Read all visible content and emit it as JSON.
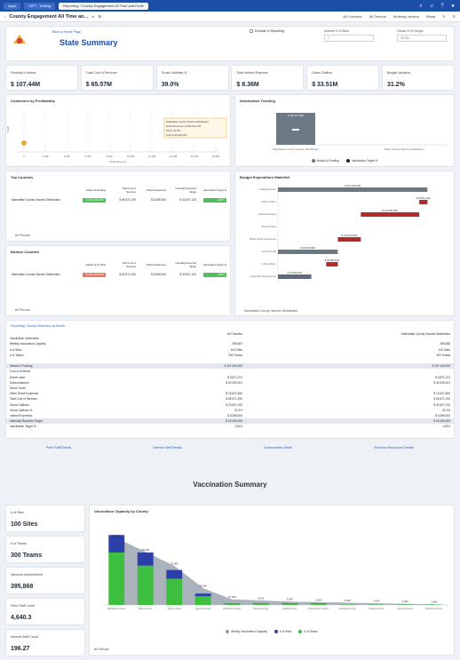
{
  "topnav": {
    "apps": "Apps",
    "tab1": "CIFT - Testing",
    "tab2": "Reporting / County Engagement All Time and Profit"
  },
  "subbar": {
    "title": "County Engagement All Time an...",
    "filter1": "All Counties",
    "filter2": "All Periods",
    "filter3": "Working Version",
    "filter4": "Reset"
  },
  "header": {
    "back_link": "Back to Home Page",
    "title": "State Summary",
    "checkbox_label": "Exclude in Reporting",
    "field1_label": "Number # & Rank",
    "field1_value": "7",
    "field2_label": "Global Of % Target",
    "field2_value": "90.0%"
  },
  "kpis": [
    {
      "label": "Funding & Inflows",
      "value": "$ 107.44M"
    },
    {
      "label": "Total Cost of Services",
      "value": "$ 65.57M"
    },
    {
      "label": "Gross Outflows %",
      "value": "39.0%"
    },
    {
      "label": "Total Indirect Expense",
      "value": "$ 8.36M"
    },
    {
      "label": "Gross Outflow",
      "value": "$ 33.51M"
    },
    {
      "label": "Budget Variance",
      "value": "31.2%"
    }
  ],
  "customers_chart": {
    "title": "Customers by Profitability",
    "ylabel": "Profit",
    "xlabel": "Total Revenue",
    "xticks": [
      "0",
      "2.0M",
      "4.0M",
      "6.0M",
      "8.0M",
      "10.0M",
      "12.0M",
      "14.0M",
      "16.0M",
      "18.0M"
    ],
    "tooltip_title": "Manhattan County Vaccine Distribution",
    "tooltip_l1": "Gross Revenue: $ 103,012,178",
    "tooltip_l2": "Profit: 10.3%",
    "tooltip_l3": "Cost: $ 19,301,241"
  },
  "distribution_chart": {
    "title": "Distribution Tracking",
    "bar_label": "$ 105,477,886",
    "cat1": "Manhattan County Vaccine Distribution",
    "cat2": "Other County Vaccine Distribution",
    "legend1": "Inflows & Funding",
    "legend2": "Vaccination Target %"
  },
  "top_counties": {
    "title": "Top Counties",
    "headers": [
      "Inflows & Funding",
      "Total Cost of Services",
      "Indirect Expenses",
      "Internally Reported Target",
      "Vaccination Target %"
    ],
    "row_name": "Manhattan County Vaccine Distribution",
    "row_values": [
      "$ 107,440,000",
      "$ 65,571,200",
      "$ 8,358,944",
      "$ 33,507,100",
      "100%"
    ],
    "footer": "All Periods"
  },
  "bottom_counties": {
    "title": "Bottom Counties",
    "headers": [
      "Inflows & Funding",
      "Total Cost of Services",
      "Indirect Expenses",
      "Internally Reported Target",
      "Vaccination Target %"
    ],
    "row_name": "Manhattan County Vaccine Distribution",
    "row_values": [
      "$ 107,440,000",
      "$ 65,571,200",
      "$ 8,358,944",
      "$ 33,507,100",
      "100%"
    ],
    "footer": "All Periods"
  },
  "waterfall": {
    "title": "Budget Expenditure Waterfall",
    "categories": [
      "Total Revenue",
      "Direct Labor",
      "Subcontractors",
      "Direct Travel",
      "Other Direct Expenses",
      "Gross Profit",
      "Indirect Exp.",
      "Internally Reported Gr"
    ],
    "value_labels": [
      "$ 107,440,000",
      "$ (5,871,221)",
      "$ (42,000,001)",
      "",
      "$ (16,521,860)",
      "$ 33,506,684",
      "$ (8,358,944)",
      "$ 24,000,000"
    ],
    "footer": "Manhattan County Vaccine Distribution"
  },
  "monthly": {
    "title": "Reporting: County Summary by Month",
    "col1": "All Counties",
    "col2": "Manhattan County Vaccine Distribution",
    "rows": [
      {
        "label": "Vaccination Information",
        "v1": "",
        "v2": ""
      },
      {
        "label": "Weekly Vaccination Capacity",
        "v1": "395,867",
        "v2": "395,868"
      },
      {
        "label": "# of Sites",
        "v1": "100 Sites",
        "v2": "100 Sites"
      },
      {
        "label": "# of Teams",
        "v1": "300 Teams",
        "v2": "300 Teams"
      },
      {
        "label": "",
        "v1": "",
        "v2": ""
      },
      {
        "label": "Inflows & Funding",
        "v1": "$ 107,440,000",
        "v2": "$ 107,440,000",
        "hl": true
      },
      {
        "label": "Cost of Services",
        "v1": "",
        "v2": ""
      },
      {
        "label": "Direct Labor",
        "v1": "$ 5,871,221",
        "v2": "$ 5,871,221"
      },
      {
        "label": "Subcontractors",
        "v1": "$ 42,000,001",
        "v2": "$ 42,000,001"
      },
      {
        "label": "Direct Travel",
        "v1": "",
        "v2": ""
      },
      {
        "label": "Other Direct Expenses",
        "v1": "$ 16,521,860",
        "v2": "$ 16,521,860"
      },
      {
        "label": "Total Cost of Services",
        "v1": "$ 65,571,200",
        "v2": "$ 65,571,200"
      },
      {
        "label": "Gross Outflows",
        "v1": "$ 33,507,100",
        "v2": "$ 33,507,100"
      },
      {
        "label": "Gross Outflows %",
        "v1": "31.2%",
        "v2": "31.2%"
      },
      {
        "label": "Indirect Expenses",
        "v1": "$ 8,358,944",
        "v2": "$ 8,358,944"
      },
      {
        "label": "Internally Reported Target",
        "v1": "$ 24,000,000",
        "v2": "$ 24,000,000",
        "hl": true
      },
      {
        "label": "Vaccination Target %",
        "v1": "100%",
        "v2": "100%"
      }
    ]
  },
  "links": [
    "Point Staff Details",
    "Internal Staff Details",
    "Consumables Detail",
    "Technical Resources Details"
  ],
  "vaccination": {
    "title": "Vaccination Summary",
    "side_kpis": [
      {
        "label": "# of Sites",
        "value": "100 Sites"
      },
      {
        "label": "# of Teams",
        "value": "300 Teams"
      },
      {
        "label": "Vaccines Administered",
        "value": "395,868"
      },
      {
        "label": "Point Staff Count",
        "value": "4,640.3"
      },
      {
        "label": "Internal Staff Count",
        "value": "196.27"
      }
    ],
    "chart_title": "Vaccination Capacity by County",
    "legend1": "Weekly Vaccination Capacity",
    "legend2": "# of Sites",
    "legend3": "# of Teams",
    "footer": "All Periods"
  },
  "chart_data": [
    {
      "type": "bar",
      "title": "Budget Expenditure Waterfall",
      "categories": [
        "Total Revenue",
        "Direct Labor",
        "Subcontractors",
        "Direct Travel",
        "Other Direct Expenses",
        "Gross Profit",
        "Indirect Exp.",
        "Internally Reported Gr"
      ],
      "values": [
        107440000,
        -5871221,
        -42000001,
        0,
        -16521860,
        33506684,
        -8358944,
        24000000
      ]
    },
    {
      "type": "bar",
      "title": "Vaccination Capacity by County",
      "categories": [
        "Manhattan County",
        "Bronx County",
        "Kings County",
        "Queens County",
        "Richmond County",
        "Nassau County",
        "Suffolk County",
        "Westchester County",
        "Rockland County",
        "Orange County",
        "Putnam County",
        "Dutchess County"
      ],
      "series": [
        {
          "name": "Weekly Vaccination Capacity",
          "values": [
            120000,
            95000,
            70000,
            30000,
            10000,
            8000,
            6000,
            5000,
            4000,
            3000,
            2000,
            1500
          ]
        },
        {
          "name": "# of Sites",
          "values": [
            40,
            30,
            20,
            6,
            1,
            1,
            1,
            1,
            0,
            0,
            0,
            0
          ]
        },
        {
          "name": "# of Teams",
          "values": [
            120,
            90,
            60,
            20,
            2,
            2,
            2,
            2,
            1,
            1,
            1,
            1
          ]
        }
      ],
      "colors": [
        "#8e99a6",
        "#2b3fa6",
        "#3fbf3f"
      ]
    }
  ]
}
